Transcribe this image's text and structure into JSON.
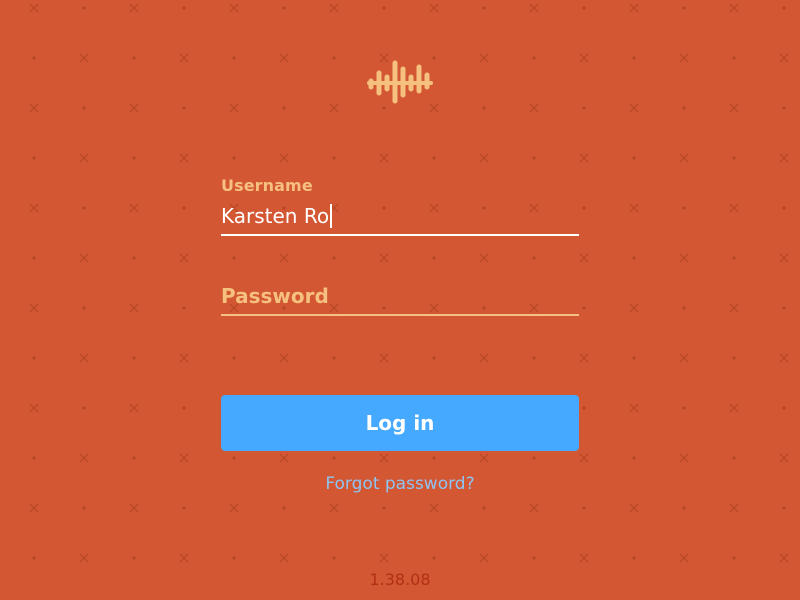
{
  "theme": {
    "background": "#d35733",
    "accent_peach": "#f6c07e",
    "button_blue": "#45a9ff",
    "link_blue": "#8fc3f1",
    "version_red": "#b22f14"
  },
  "logo": {
    "icon": "waveform-logo-icon"
  },
  "username": {
    "label": "Username",
    "value": "Karsten Ro"
  },
  "password": {
    "placeholder": "Password",
    "value": ""
  },
  "login_button": {
    "label": "Log in"
  },
  "forgot_link": {
    "label": "Forgot password?"
  },
  "version": "1.38.08"
}
